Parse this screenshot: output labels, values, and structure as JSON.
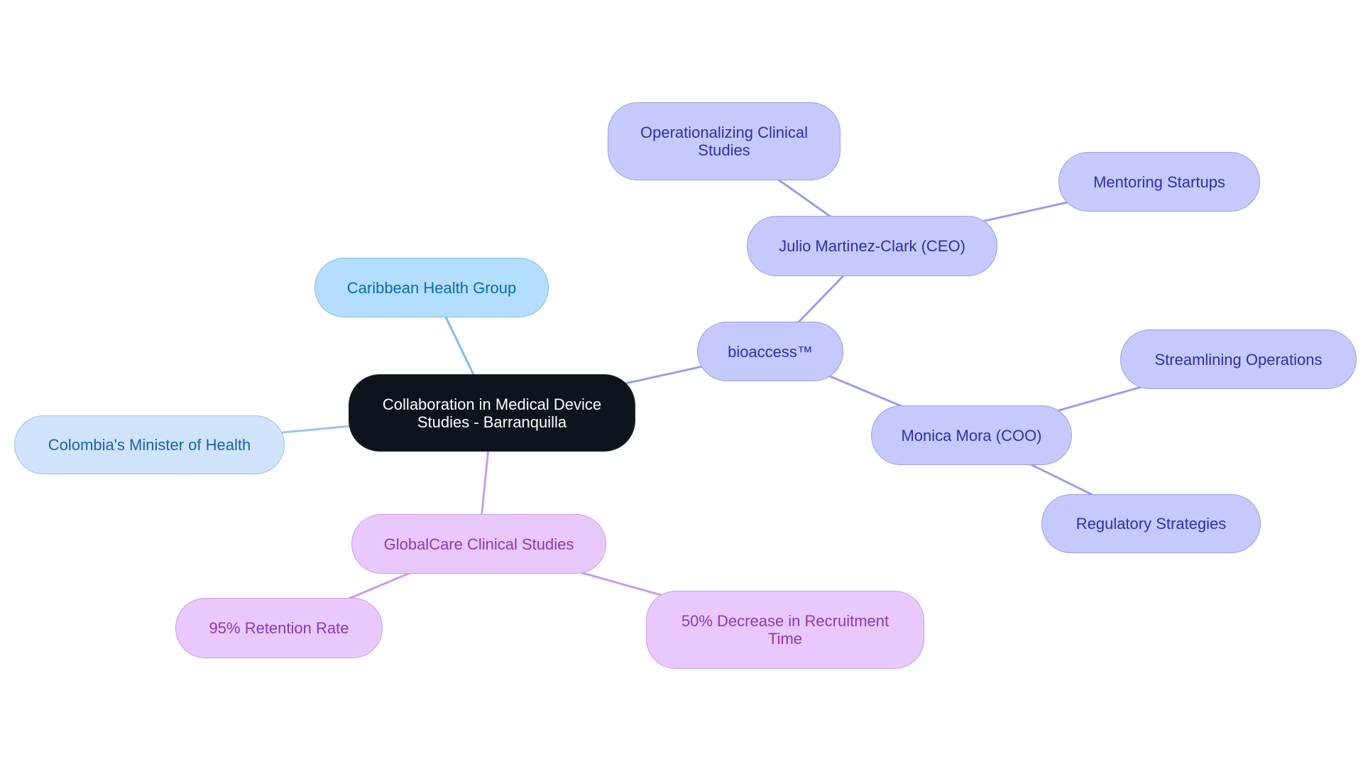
{
  "diagram": {
    "type": "mind-map",
    "root": {
      "id": "root",
      "label": "Collaboration in Medical Device\nStudies - Barranquilla"
    },
    "nodes": [
      {
        "id": "caribbean",
        "label": "Caribbean Health Group",
        "parent": "root",
        "branch": "blue1"
      },
      {
        "id": "colombia",
        "label": "Colombia's Minister of Health",
        "parent": "root",
        "branch": "blue2"
      },
      {
        "id": "bioaccess",
        "label": "bioaccess™",
        "parent": "root",
        "branch": "indigo"
      },
      {
        "id": "julio",
        "label": "Julio Martinez-Clark (CEO)",
        "parent": "bioaccess",
        "branch": "indigo"
      },
      {
        "id": "operationalizing",
        "label": "Operationalizing Clinical\nStudies",
        "parent": "julio",
        "branch": "indigo"
      },
      {
        "id": "mentoring",
        "label": "Mentoring Startups",
        "parent": "julio",
        "branch": "indigo"
      },
      {
        "id": "monica",
        "label": "Monica Mora (COO)",
        "parent": "bioaccess",
        "branch": "indigo"
      },
      {
        "id": "streamlining",
        "label": "Streamlining Operations",
        "parent": "monica",
        "branch": "indigo"
      },
      {
        "id": "regulatory",
        "label": "Regulatory Strategies",
        "parent": "monica",
        "branch": "indigo"
      },
      {
        "id": "globalcare",
        "label": "GlobalCare Clinical Studies",
        "parent": "root",
        "branch": "purple"
      },
      {
        "id": "retention",
        "label": "95% Retention Rate",
        "parent": "globalcare",
        "branch": "purple"
      },
      {
        "id": "recruitment",
        "label": "50% Decrease in Recruitment\nTime",
        "parent": "globalcare",
        "branch": "purple"
      }
    ],
    "colors": {
      "root_fill": "#0d141b",
      "blue1_edge": "#7fbde8",
      "blue2_edge": "#9cc3ea",
      "indigo_edge": "#9b9ee9",
      "purple_edge": "#cc9be8"
    }
  }
}
